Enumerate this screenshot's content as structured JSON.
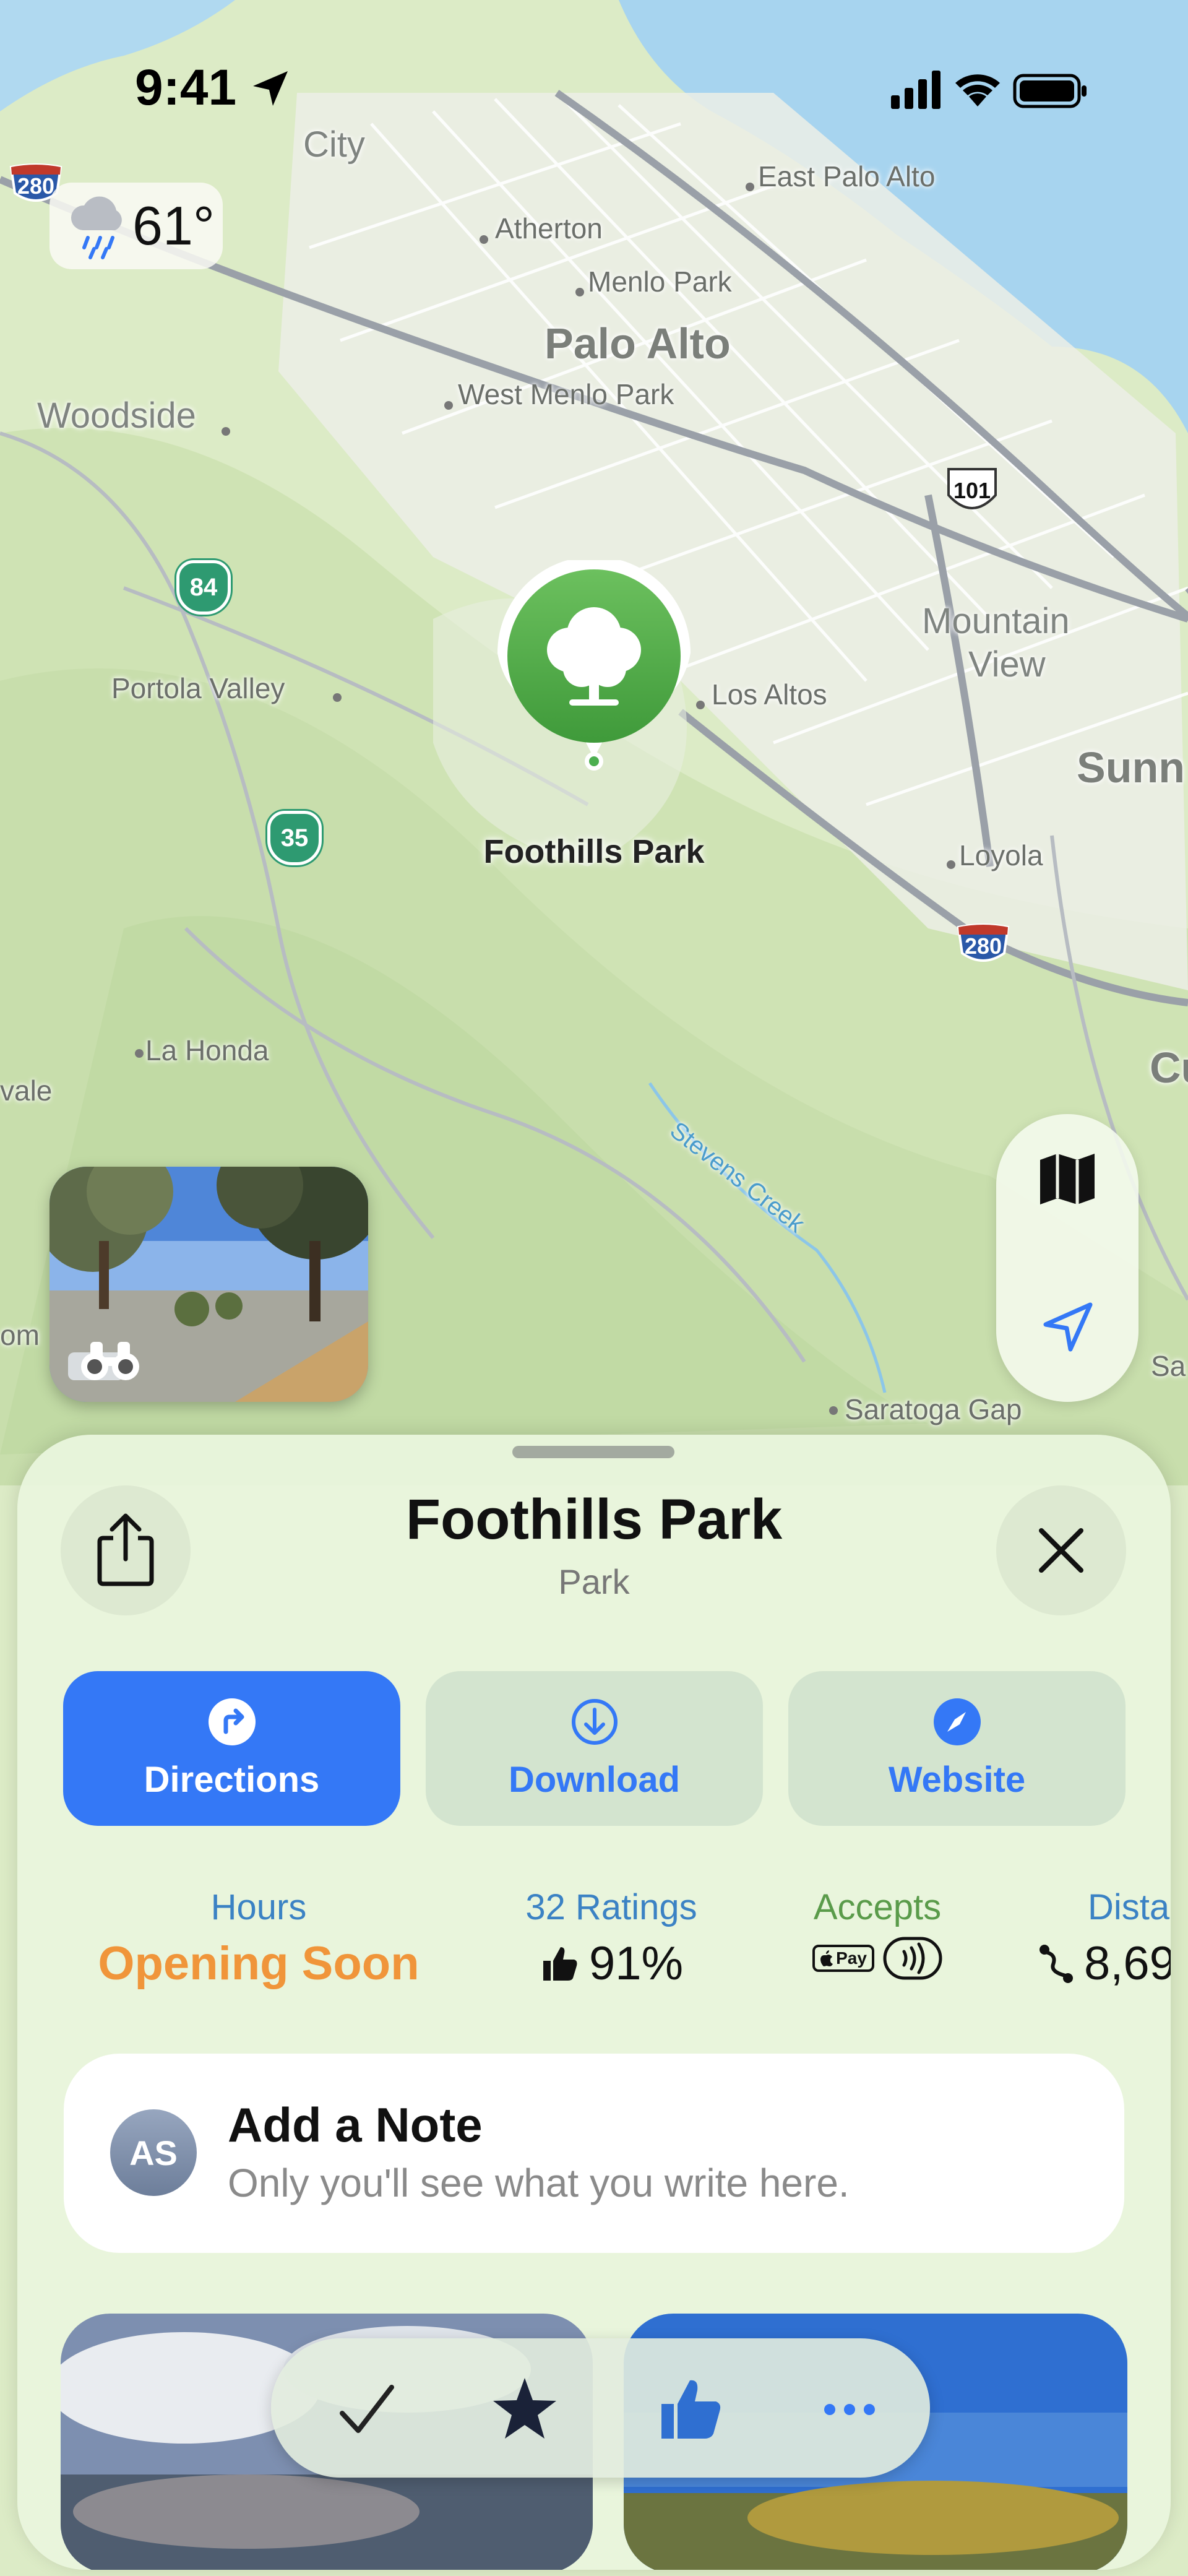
{
  "status_bar": {
    "time": "9:41"
  },
  "weather": {
    "temperature": "61°",
    "icon": "cloud-rain-icon"
  },
  "map": {
    "places": [
      {
        "label": "City"
      },
      {
        "label": "East Palo Alto"
      },
      {
        "label": "Atherton"
      },
      {
        "label": "Menlo Park"
      },
      {
        "label": "Palo Alto"
      },
      {
        "label": "West Menlo Park"
      },
      {
        "label": "Woodside"
      },
      {
        "label": "Mountain"
      },
      {
        "label": "View"
      },
      {
        "label": "Los Altos"
      },
      {
        "label": "Portola Valley"
      },
      {
        "label": "Sunn"
      },
      {
        "label": "Loyola"
      },
      {
        "label": "La Honda"
      },
      {
        "label": "Stevens Creek"
      },
      {
        "label": "Saratoga Gap"
      },
      {
        "label": "vale"
      },
      {
        "label": "om"
      },
      {
        "label": "Sa"
      },
      {
        "label": "Cu"
      }
    ],
    "shields": {
      "i280_a": "280",
      "us101": "101",
      "ca84": "84",
      "ca35": "35",
      "i280_b": "280"
    },
    "pin": {
      "label": "Foothills Park",
      "icon": "tree-icon",
      "color": "#4caf50"
    }
  },
  "sheet": {
    "title": "Foothills Park",
    "subtitle": "Park",
    "actions": {
      "directions": "Directions",
      "download": "Download",
      "website": "Website"
    },
    "info": {
      "hours_label": "Hours",
      "hours_value": "Opening Soon",
      "ratings_label": "32 Ratings",
      "ratings_value": "91%",
      "accepts_label": "Accepts",
      "accepts_apple_pay": "Pay",
      "distance_label": "Distar",
      "distance_value": "8,69"
    },
    "note": {
      "initials": "AS",
      "title": "Add a Note",
      "placeholder": "Only you'll see what you write here."
    }
  },
  "colors": {
    "accent": "#3478f6",
    "orange": "#f0953a",
    "green": "#4caf50"
  }
}
